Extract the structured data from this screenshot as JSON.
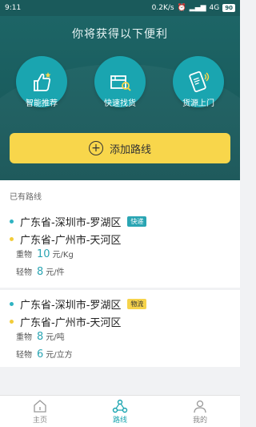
{
  "status": {
    "time": "9:11",
    "network_speed": "0.2K/s",
    "signal_label": "4G",
    "battery": "90"
  },
  "hero": {
    "title": "你将获得以下便利",
    "benefits": [
      {
        "label": "智能推荐",
        "icon": "thumbs-up-icon"
      },
      {
        "label": "快速找货",
        "icon": "box-search-icon"
      },
      {
        "label": "货源上门",
        "icon": "phone-delivery-icon"
      }
    ],
    "add_route_label": "添加路线"
  },
  "section_label": "已有路线",
  "routes": [
    {
      "from": "广东省-深圳市-罗湖区",
      "to": "广东省-广州市-天河区",
      "tag": "快递",
      "heavy_label": "重物",
      "heavy_price": "10",
      "heavy_unit": "元/Kg",
      "light_label": "轻物",
      "light_price": "8",
      "light_unit": "元/件"
    },
    {
      "from": "广东省-深圳市-罗湖区",
      "to": "广东省-广州市-天河区",
      "tag": "物流",
      "heavy_label": "重物",
      "heavy_price": "8",
      "heavy_unit": "元/吨",
      "light_label": "轻物",
      "light_price": "6",
      "light_unit": "元/立方"
    }
  ],
  "nav": {
    "home": "主页",
    "routes": "路线",
    "mine": "我的"
  }
}
